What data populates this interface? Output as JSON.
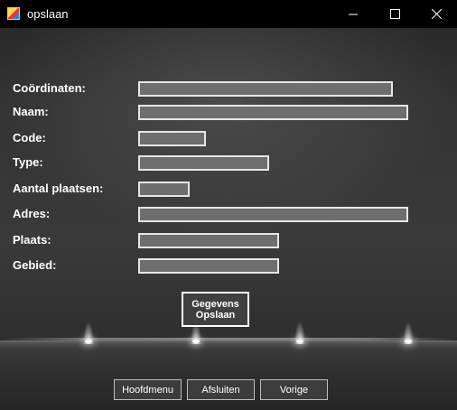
{
  "window": {
    "title": "opslaan",
    "icons": [
      "app-icon",
      "minimize-icon",
      "maximize-icon",
      "close-icon"
    ]
  },
  "form": {
    "fields": [
      {
        "label": "Coördinaten:",
        "value": ""
      },
      {
        "label": "Naam:",
        "value": ""
      },
      {
        "label": "Code:",
        "value": ""
      },
      {
        "label": "Type:",
        "value": ""
      },
      {
        "label": "Aantal plaatsen:",
        "value": ""
      },
      {
        "label": "Adres:",
        "value": ""
      },
      {
        "label": "Plaats:",
        "value": ""
      },
      {
        "label": "Gebied:",
        "value": ""
      }
    ],
    "save_button_line1": "Gegevens",
    "save_button_line2": "Opslaan"
  },
  "nav": {
    "hoofdmenu": "Hoofdmenu",
    "afsluiten": "Afsluiten",
    "vorige": "Vorige"
  },
  "colors": {
    "field_fill": "#6e6e6e",
    "field_border": "#e6e6e6",
    "label_text": "#ffffff"
  }
}
